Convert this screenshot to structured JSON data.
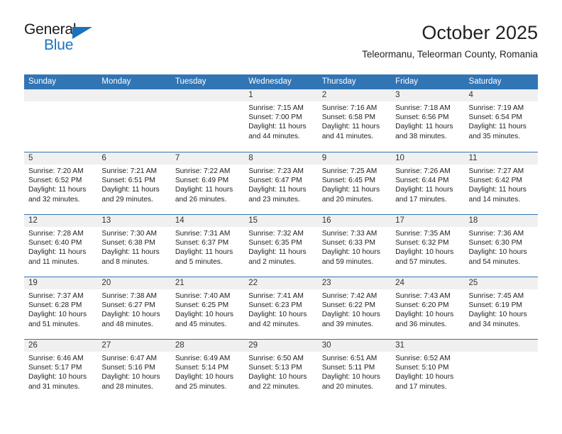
{
  "brand": {
    "name_part1": "General",
    "name_part2": "Blue",
    "accent_color": "#1c72bb"
  },
  "header": {
    "title": "October 2025",
    "subtitle": "Teleormanu, Teleorman County, Romania"
  },
  "calendar": {
    "header_color": "#3175b4",
    "weekdays": [
      "Sunday",
      "Monday",
      "Tuesday",
      "Wednesday",
      "Thursday",
      "Friday",
      "Saturday"
    ],
    "weeks": [
      [
        {
          "day": "",
          "sunrise": "",
          "sunset": "",
          "daylight": "",
          "daylight2": ""
        },
        {
          "day": "",
          "sunrise": "",
          "sunset": "",
          "daylight": "",
          "daylight2": ""
        },
        {
          "day": "",
          "sunrise": "",
          "sunset": "",
          "daylight": "",
          "daylight2": ""
        },
        {
          "day": "1",
          "sunrise": "Sunrise: 7:15 AM",
          "sunset": "Sunset: 7:00 PM",
          "daylight": "Daylight: 11 hours",
          "daylight2": "and 44 minutes."
        },
        {
          "day": "2",
          "sunrise": "Sunrise: 7:16 AM",
          "sunset": "Sunset: 6:58 PM",
          "daylight": "Daylight: 11 hours",
          "daylight2": "and 41 minutes."
        },
        {
          "day": "3",
          "sunrise": "Sunrise: 7:18 AM",
          "sunset": "Sunset: 6:56 PM",
          "daylight": "Daylight: 11 hours",
          "daylight2": "and 38 minutes."
        },
        {
          "day": "4",
          "sunrise": "Sunrise: 7:19 AM",
          "sunset": "Sunset: 6:54 PM",
          "daylight": "Daylight: 11 hours",
          "daylight2": "and 35 minutes."
        }
      ],
      [
        {
          "day": "5",
          "sunrise": "Sunrise: 7:20 AM",
          "sunset": "Sunset: 6:52 PM",
          "daylight": "Daylight: 11 hours",
          "daylight2": "and 32 minutes."
        },
        {
          "day": "6",
          "sunrise": "Sunrise: 7:21 AM",
          "sunset": "Sunset: 6:51 PM",
          "daylight": "Daylight: 11 hours",
          "daylight2": "and 29 minutes."
        },
        {
          "day": "7",
          "sunrise": "Sunrise: 7:22 AM",
          "sunset": "Sunset: 6:49 PM",
          "daylight": "Daylight: 11 hours",
          "daylight2": "and 26 minutes."
        },
        {
          "day": "8",
          "sunrise": "Sunrise: 7:23 AM",
          "sunset": "Sunset: 6:47 PM",
          "daylight": "Daylight: 11 hours",
          "daylight2": "and 23 minutes."
        },
        {
          "day": "9",
          "sunrise": "Sunrise: 7:25 AM",
          "sunset": "Sunset: 6:45 PM",
          "daylight": "Daylight: 11 hours",
          "daylight2": "and 20 minutes."
        },
        {
          "day": "10",
          "sunrise": "Sunrise: 7:26 AM",
          "sunset": "Sunset: 6:44 PM",
          "daylight": "Daylight: 11 hours",
          "daylight2": "and 17 minutes."
        },
        {
          "day": "11",
          "sunrise": "Sunrise: 7:27 AM",
          "sunset": "Sunset: 6:42 PM",
          "daylight": "Daylight: 11 hours",
          "daylight2": "and 14 minutes."
        }
      ],
      [
        {
          "day": "12",
          "sunrise": "Sunrise: 7:28 AM",
          "sunset": "Sunset: 6:40 PM",
          "daylight": "Daylight: 11 hours",
          "daylight2": "and 11 minutes."
        },
        {
          "day": "13",
          "sunrise": "Sunrise: 7:30 AM",
          "sunset": "Sunset: 6:38 PM",
          "daylight": "Daylight: 11 hours",
          "daylight2": "and 8 minutes."
        },
        {
          "day": "14",
          "sunrise": "Sunrise: 7:31 AM",
          "sunset": "Sunset: 6:37 PM",
          "daylight": "Daylight: 11 hours",
          "daylight2": "and 5 minutes."
        },
        {
          "day": "15",
          "sunrise": "Sunrise: 7:32 AM",
          "sunset": "Sunset: 6:35 PM",
          "daylight": "Daylight: 11 hours",
          "daylight2": "and 2 minutes."
        },
        {
          "day": "16",
          "sunrise": "Sunrise: 7:33 AM",
          "sunset": "Sunset: 6:33 PM",
          "daylight": "Daylight: 10 hours",
          "daylight2": "and 59 minutes."
        },
        {
          "day": "17",
          "sunrise": "Sunrise: 7:35 AM",
          "sunset": "Sunset: 6:32 PM",
          "daylight": "Daylight: 10 hours",
          "daylight2": "and 57 minutes."
        },
        {
          "day": "18",
          "sunrise": "Sunrise: 7:36 AM",
          "sunset": "Sunset: 6:30 PM",
          "daylight": "Daylight: 10 hours",
          "daylight2": "and 54 minutes."
        }
      ],
      [
        {
          "day": "19",
          "sunrise": "Sunrise: 7:37 AM",
          "sunset": "Sunset: 6:28 PM",
          "daylight": "Daylight: 10 hours",
          "daylight2": "and 51 minutes."
        },
        {
          "day": "20",
          "sunrise": "Sunrise: 7:38 AM",
          "sunset": "Sunset: 6:27 PM",
          "daylight": "Daylight: 10 hours",
          "daylight2": "and 48 minutes."
        },
        {
          "day": "21",
          "sunrise": "Sunrise: 7:40 AM",
          "sunset": "Sunset: 6:25 PM",
          "daylight": "Daylight: 10 hours",
          "daylight2": "and 45 minutes."
        },
        {
          "day": "22",
          "sunrise": "Sunrise: 7:41 AM",
          "sunset": "Sunset: 6:23 PM",
          "daylight": "Daylight: 10 hours",
          "daylight2": "and 42 minutes."
        },
        {
          "day": "23",
          "sunrise": "Sunrise: 7:42 AM",
          "sunset": "Sunset: 6:22 PM",
          "daylight": "Daylight: 10 hours",
          "daylight2": "and 39 minutes."
        },
        {
          "day": "24",
          "sunrise": "Sunrise: 7:43 AM",
          "sunset": "Sunset: 6:20 PM",
          "daylight": "Daylight: 10 hours",
          "daylight2": "and 36 minutes."
        },
        {
          "day": "25",
          "sunrise": "Sunrise: 7:45 AM",
          "sunset": "Sunset: 6:19 PM",
          "daylight": "Daylight: 10 hours",
          "daylight2": "and 34 minutes."
        }
      ],
      [
        {
          "day": "26",
          "sunrise": "Sunrise: 6:46 AM",
          "sunset": "Sunset: 5:17 PM",
          "daylight": "Daylight: 10 hours",
          "daylight2": "and 31 minutes."
        },
        {
          "day": "27",
          "sunrise": "Sunrise: 6:47 AM",
          "sunset": "Sunset: 5:16 PM",
          "daylight": "Daylight: 10 hours",
          "daylight2": "and 28 minutes."
        },
        {
          "day": "28",
          "sunrise": "Sunrise: 6:49 AM",
          "sunset": "Sunset: 5:14 PM",
          "daylight": "Daylight: 10 hours",
          "daylight2": "and 25 minutes."
        },
        {
          "day": "29",
          "sunrise": "Sunrise: 6:50 AM",
          "sunset": "Sunset: 5:13 PM",
          "daylight": "Daylight: 10 hours",
          "daylight2": "and 22 minutes."
        },
        {
          "day": "30",
          "sunrise": "Sunrise: 6:51 AM",
          "sunset": "Sunset: 5:11 PM",
          "daylight": "Daylight: 10 hours",
          "daylight2": "and 20 minutes."
        },
        {
          "day": "31",
          "sunrise": "Sunrise: 6:52 AM",
          "sunset": "Sunset: 5:10 PM",
          "daylight": "Daylight: 10 hours",
          "daylight2": "and 17 minutes."
        },
        {
          "day": "",
          "sunrise": "",
          "sunset": "",
          "daylight": "",
          "daylight2": ""
        }
      ]
    ]
  }
}
